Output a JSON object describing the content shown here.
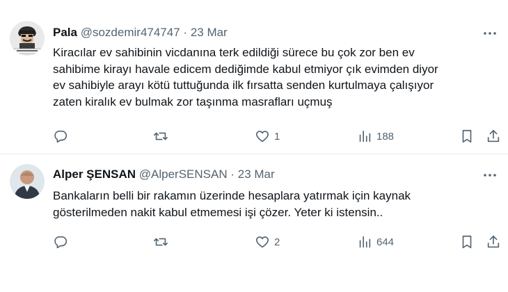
{
  "tweets": [
    {
      "name": "Pala",
      "handle": "@sozdemir474747",
      "separator": "·",
      "date": "23 Mar",
      "lines": [
        "Kiracılar ev sahibinin vicdanına terk edildiği sürece bu çok zor ben ev",
        "sahibime kirayı havale edicem dediğimde kabul etmiyor çık evimden diyor",
        "ev sahibiyle arayı kötü tuttuğunda ilk fırsatta senden kurtulmaya çalışıyor",
        "zaten kiralık ev bulmak zor taşınma masrafları uçmuş"
      ],
      "likes": "1",
      "views": "188"
    },
    {
      "name": "Alper ŞENSAN",
      "handle": "@AlperSENSAN",
      "separator": "·",
      "date": "23 Mar",
      "lines": [
        "Bankaların belli bir rakamın üzerinde hesaplara yatırmak için kaynak",
        "gösterilmeden nakit kabul etmemesi işi çözer.  Yeter ki istensin.."
      ],
      "likes": "2",
      "views": "644"
    }
  ],
  "icons": {
    "more": "more-horizontal-icon",
    "reply": "reply-icon",
    "retweet": "retweet-icon",
    "like": "heart-icon",
    "views": "views-chart-icon",
    "bookmark": "bookmark-icon",
    "share": "share-icon"
  },
  "colors": {
    "text": "#0f1419",
    "secondary": "#536471",
    "divider": "#e6ecf0"
  }
}
